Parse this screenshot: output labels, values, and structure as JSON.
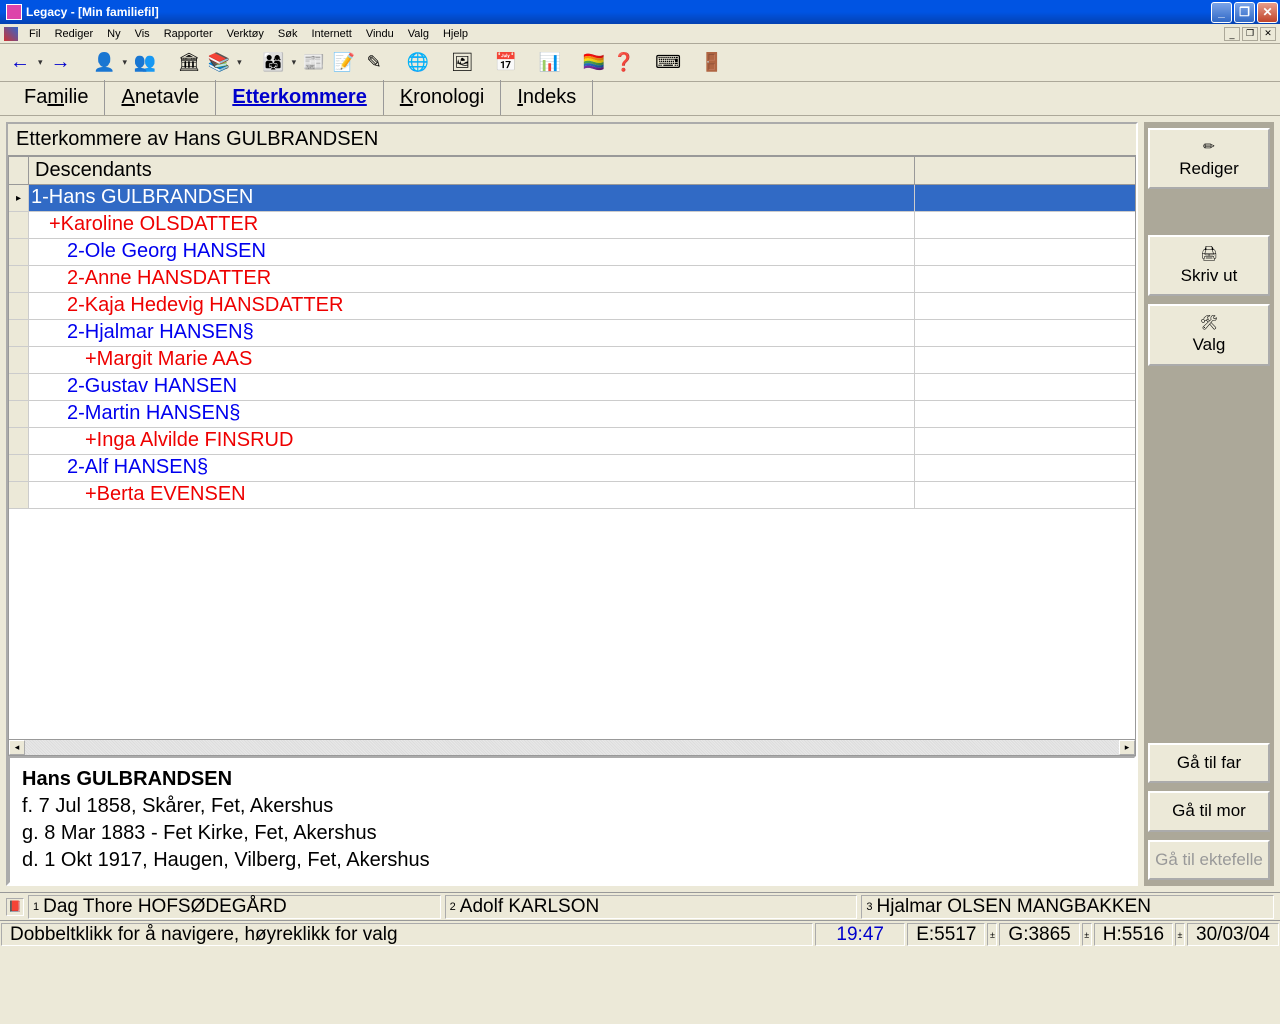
{
  "window": {
    "app_name": "Legacy",
    "doc_name": "[Min familiefil]"
  },
  "menubar": [
    "Fil",
    "Rediger",
    "Ny",
    "Vis",
    "Rapporter",
    "Verktøy",
    "Søk",
    "Internett",
    "Vindu",
    "Valg",
    "Hjelp"
  ],
  "tabs": {
    "familie": "Familie",
    "anetavle": "Anetavle",
    "etterkommere": "Etterkommere",
    "kronologi": "Kronologi",
    "indeks": "Indeks",
    "active": "etterkommere"
  },
  "panel": {
    "title": "Etterkommere av Hans GULBRANDSEN",
    "header": "Descendants"
  },
  "rows": [
    {
      "text": "1-Hans GULBRANDSEN",
      "indent": 0,
      "color": "blue",
      "selected": true
    },
    {
      "text": "+Karoline OLSDATTER",
      "indent": 1,
      "color": "red",
      "selected": false
    },
    {
      "text": "2-Ole Georg HANSEN",
      "indent": 2,
      "color": "blue",
      "selected": false
    },
    {
      "text": "2-Anne HANSDATTER",
      "indent": 2,
      "color": "red",
      "selected": false
    },
    {
      "text": "2-Kaja Hedevig HANSDATTER",
      "indent": 2,
      "color": "red",
      "selected": false
    },
    {
      "text": "2-Hjalmar HANSEN§",
      "indent": 2,
      "color": "blue",
      "selected": false
    },
    {
      "text": "+Margit Marie AAS",
      "indent": 3,
      "color": "red",
      "selected": false
    },
    {
      "text": "2-Gustav HANSEN",
      "indent": 2,
      "color": "blue",
      "selected": false
    },
    {
      "text": "2-Martin HANSEN§",
      "indent": 2,
      "color": "blue",
      "selected": false
    },
    {
      "text": "+Inga Alvilde FINSRUD",
      "indent": 3,
      "color": "red",
      "selected": false
    },
    {
      "text": "2-Alf HANSEN§",
      "indent": 2,
      "color": "blue",
      "selected": false
    },
    {
      "text": "+Berta EVENSEN",
      "indent": 3,
      "color": "red",
      "selected": false
    }
  ],
  "detail": {
    "name": "Hans GULBRANDSEN",
    "birth": "f.  7 Jul 1858, Skårer, Fet, Akershus",
    "marriage": "g.  8 Mar 1883 - Fet Kirke, Fet, Akershus",
    "death": "d.  1 Okt 1917, Haugen, Vilberg, Fet, Akershus"
  },
  "sidebar": {
    "rediger": "Rediger",
    "skrivut": "Skriv ut",
    "valg": "Valg",
    "gafar": "Gå til far",
    "gamor": "Gå til mor",
    "gaekte": "Gå til ektefelle"
  },
  "bookmarks": {
    "b1": "Dag Thore HOFSØDEGÅRD",
    "b2": "Adolf KARLSON",
    "b3": "Hjalmar OLSEN MANGBAKKEN"
  },
  "status": {
    "hint": "Dobbeltklikk for å navigere, høyreklikk for valg",
    "time": "19:47",
    "e": "E:5517",
    "g": "G:3865",
    "h": "H:5516",
    "date": "30/03/04"
  }
}
